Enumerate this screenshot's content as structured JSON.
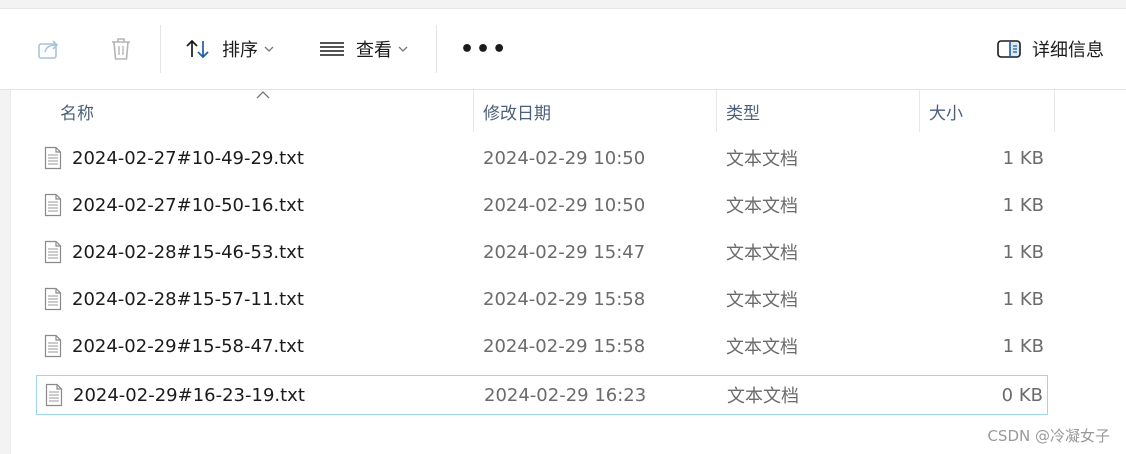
{
  "toolbar": {
    "share_icon": "share-icon",
    "delete_icon": "trash-icon",
    "sort_label": "排序",
    "view_label": "查看",
    "more_label": "•••",
    "details_label": "详细信息"
  },
  "columns": {
    "name": "名称",
    "date": "修改日期",
    "type": "类型",
    "size": "大小"
  },
  "files": [
    {
      "name": "2024-02-27#10-49-29.txt",
      "date": "2024-02-29 10:50",
      "type": "文本文档",
      "size": "1 KB",
      "selected": false
    },
    {
      "name": "2024-02-27#10-50-16.txt",
      "date": "2024-02-29 10:50",
      "type": "文本文档",
      "size": "1 KB",
      "selected": false
    },
    {
      "name": "2024-02-28#15-46-53.txt",
      "date": "2024-02-29 15:47",
      "type": "文本文档",
      "size": "1 KB",
      "selected": false
    },
    {
      "name": "2024-02-28#15-57-11.txt",
      "date": "2024-02-29 15:58",
      "type": "文本文档",
      "size": "1 KB",
      "selected": false
    },
    {
      "name": "2024-02-29#15-58-47.txt",
      "date": "2024-02-29 15:58",
      "type": "文本文档",
      "size": "1 KB",
      "selected": false
    },
    {
      "name": "2024-02-29#16-23-19.txt",
      "date": "2024-02-29 16:23",
      "type": "文本文档",
      "size": "0 KB",
      "selected": true
    }
  ],
  "watermark": "CSDN @冷凝女子",
  "colors": {
    "header_text": "#4c607a",
    "selection_border": "#9ed6ee",
    "secondary_text": "#6b6b6b"
  }
}
